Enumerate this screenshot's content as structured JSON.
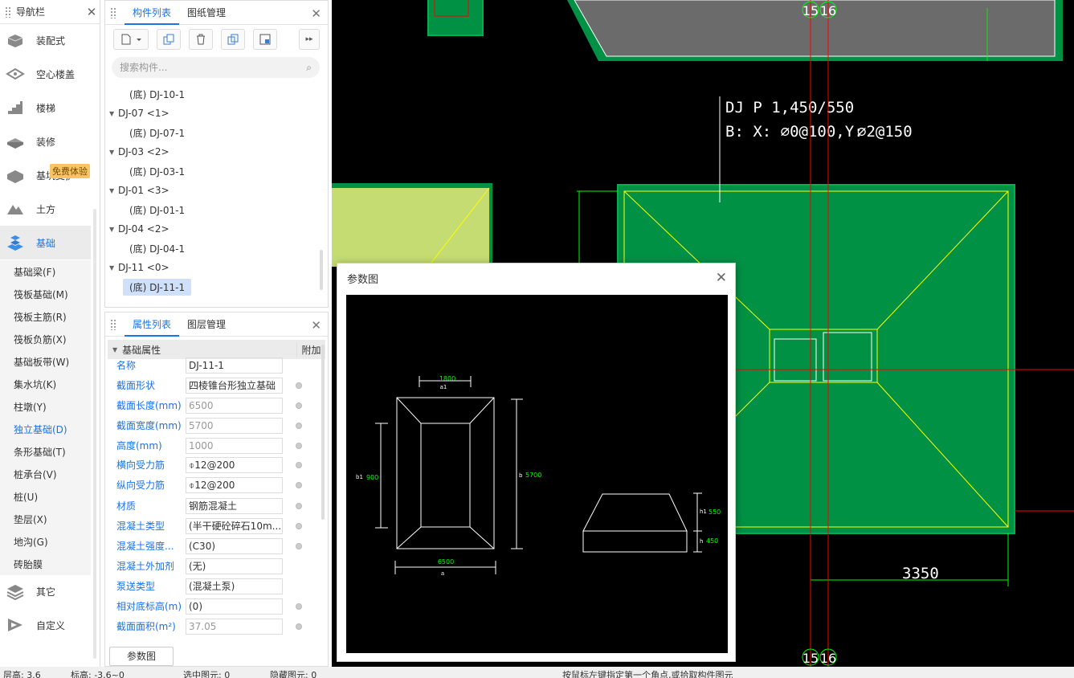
{
  "nav": {
    "title": "导航栏",
    "categories": [
      {
        "label": "装配式"
      },
      {
        "label": "空心楼盖"
      },
      {
        "label": "楼梯"
      },
      {
        "label": "装修"
      },
      {
        "label": "基坑支护"
      },
      {
        "label": "土方"
      },
      {
        "label": "基础"
      },
      {
        "label": "其它"
      },
      {
        "label": "自定义"
      }
    ],
    "badge": "免费体验",
    "sub_items": [
      {
        "label": "基础梁(F)"
      },
      {
        "label": "筏板基础(M)"
      },
      {
        "label": "筏板主筋(R)"
      },
      {
        "label": "筏板负筋(X)"
      },
      {
        "label": "基础板带(W)"
      },
      {
        "label": "集水坑(K)"
      },
      {
        "label": "柱墩(Y)"
      },
      {
        "label": "独立基础(D)"
      },
      {
        "label": "条形基础(T)"
      },
      {
        "label": "桩承台(V)"
      },
      {
        "label": "桩(U)"
      },
      {
        "label": "垫层(X)"
      },
      {
        "label": "地沟(G)"
      },
      {
        "label": "砖胎膜"
      }
    ]
  },
  "component_panel": {
    "tabs": [
      "构件列表",
      "图纸管理"
    ],
    "search_placeholder": "搜索构件...",
    "tree": [
      {
        "type": "leaf",
        "label": "(底) DJ-10-1"
      },
      {
        "type": "group",
        "label": "DJ-07 <1>"
      },
      {
        "type": "leaf",
        "label": "(底) DJ-07-1"
      },
      {
        "type": "group",
        "label": "DJ-03 <2>"
      },
      {
        "type": "leaf",
        "label": "(底) DJ-03-1"
      },
      {
        "type": "group",
        "label": "DJ-01 <3>"
      },
      {
        "type": "leaf",
        "label": "(底) DJ-01-1"
      },
      {
        "type": "group",
        "label": "DJ-04 <2>"
      },
      {
        "type": "leaf",
        "label": "(底) DJ-04-1"
      },
      {
        "type": "group",
        "label": "DJ-11 <0>"
      },
      {
        "type": "leaf",
        "label": "(底) DJ-11-1",
        "selected": true
      }
    ]
  },
  "property_panel": {
    "tabs": [
      "属性列表",
      "图层管理"
    ],
    "section": "基础属性",
    "attach_col": "附加",
    "rows": [
      {
        "key": "名称",
        "value": "DJ-11-1",
        "gray": false,
        "check": false
      },
      {
        "key": "截面形状",
        "value": "四棱锥台形独立基础",
        "gray": false,
        "check": true
      },
      {
        "key": "截面长度(mm)",
        "value": "6500",
        "gray": true,
        "check": true
      },
      {
        "key": "截面宽度(mm)",
        "value": "5700",
        "gray": true,
        "check": true
      },
      {
        "key": "高度(mm)",
        "value": "1000",
        "gray": true,
        "check": true
      },
      {
        "key": "横向受力筋",
        "value": "⌽12@200",
        "gray": false,
        "check": true
      },
      {
        "key": "纵向受力筋",
        "value": "⌽12@200",
        "gray": false,
        "check": true
      },
      {
        "key": "材质",
        "value": "钢筋混凝土",
        "gray": false,
        "check": true
      },
      {
        "key": "混凝土类型",
        "value": "(半干硬砼碎石10m...",
        "gray": false,
        "check": true
      },
      {
        "key": "混凝土强度...",
        "value": "(C30)",
        "gray": false,
        "check": true
      },
      {
        "key": "混凝土外加剂",
        "value": "(无)",
        "gray": false,
        "check": false
      },
      {
        "key": "泵送类型",
        "value": "(混凝土泵)",
        "gray": false,
        "check": false
      },
      {
        "key": "相对底标高(m)",
        "value": "(0)",
        "gray": false,
        "check": true
      },
      {
        "key": "截面面积(m²)",
        "value": "37.05",
        "gray": true,
        "check": true
      }
    ],
    "param_button": "参数图"
  },
  "cad": {
    "axis_labels_top": [
      "15",
      "16"
    ],
    "axis_labels_bottom": [
      "15",
      "16"
    ],
    "annotation_line1": "DJ P 1,450/550",
    "annotation_line2": "B: X:  ⌀0@100,Y:",
    "annotation_rebar2": "⌀2@150",
    "dimension": "3350",
    "colors": {
      "green_fill": "#009145",
      "light_fill": "#c5dc72",
      "gray_fill": "#6b6b6b",
      "yellow": "#ffff00",
      "red": "#ff0000"
    }
  },
  "dialog": {
    "title": "参数图",
    "plan_top_dim": "1800",
    "plan_top_label": "a1",
    "plan_left_label": "b1",
    "plan_left_dim": "900",
    "plan_right_label": "b",
    "plan_right_dim": "5700",
    "plan_bottom_dim": "6500",
    "plan_bottom_label": "a",
    "section_h1_label": "h1",
    "section_h1_dim": "550",
    "section_h_label": "h",
    "section_h_dim": "450"
  },
  "status": {
    "items": [
      "层高: 3.6",
      "标高: -3.6~0",
      "选中图元: 0",
      "隐藏图元: 0",
      "按鼠标左键指定第一个角点,或拾取构件图元"
    ]
  }
}
